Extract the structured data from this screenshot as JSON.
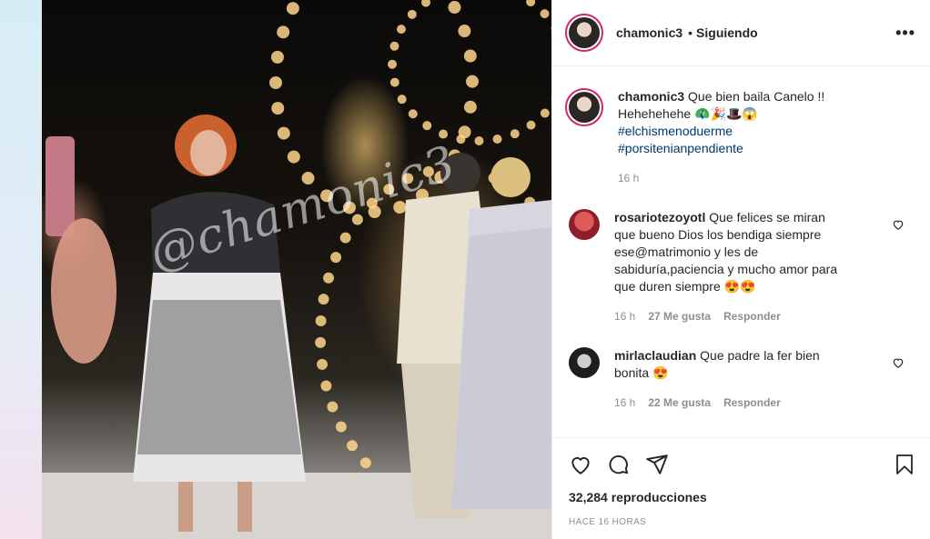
{
  "header": {
    "username": "chamonic3",
    "separator": "•",
    "follow_status": "Siguiendo",
    "more_glyph": "•••"
  },
  "media": {
    "watermark": "@chamonic3"
  },
  "caption": {
    "username": "chamonic3",
    "text": "Que bien baila Canelo !! Hehehehehe 🦚🎉🎩😱",
    "hashtags": [
      "#elchismenoduerme",
      "#porsitenianpendiente"
    ],
    "time": "16 h"
  },
  "comments": [
    {
      "username": "rosariotezoyotl",
      "text": "Que felices se miran que bueno Dios los bendiga siempre ese@matrimonio y les de sabiduría,paciencia y mucho amor para que duren siempre 😍😍",
      "time": "16 h",
      "likes": "27 Me gusta",
      "reply": "Responder"
    },
    {
      "username": "mirlaclaudian",
      "text": "Que padre la fer bien bonita 😍",
      "time": "16 h",
      "likes": "22 Me gusta",
      "reply": "Responder"
    }
  ],
  "stats": {
    "views_count": "32,284",
    "views_label": "reproducciones",
    "timestamp": "HACE 16 HORAS"
  },
  "icons": {
    "like": "heart-icon",
    "comment": "comment-icon",
    "share": "share-icon",
    "save": "bookmark-icon",
    "comment_like": "heart-icon"
  },
  "colors": {
    "link": "#00376b",
    "meta": "#8e8e8e",
    "story_ring": "#d6246e",
    "text": "#262626"
  }
}
